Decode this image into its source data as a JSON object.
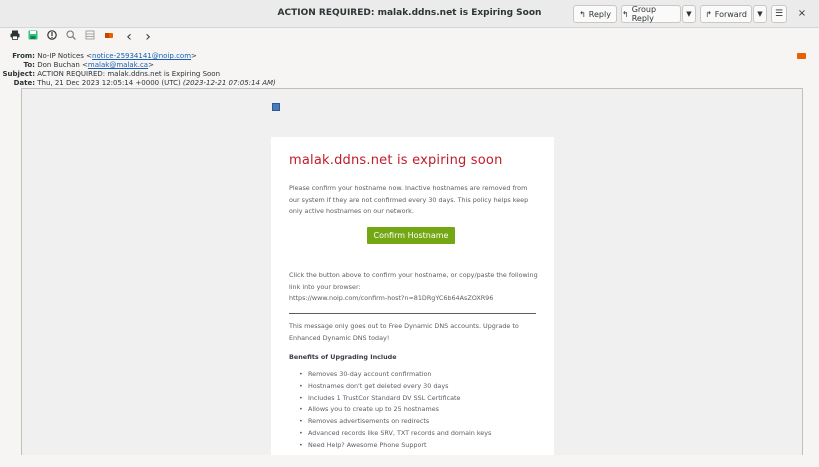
{
  "window": {
    "title": "ACTION REQUIRED: malak.ddns.net is Expiring Soon",
    "reply_label": "Reply",
    "group_reply_label": "Group Reply",
    "forward_label": "Forward",
    "close_glyph": "×",
    "dropdown_glyph": "▼",
    "menu_glyph": "☰"
  },
  "toolbar": {
    "icons": [
      "print-icon",
      "save-icon",
      "info-icon",
      "zoom-icon",
      "grid-icon",
      "flag-icon",
      "back-icon",
      "forward-icon"
    ],
    "back_glyph": "‹",
    "forward_glyph": "›"
  },
  "headers": {
    "from_label": "From:",
    "from_name": "No-IP Notices <",
    "from_email": "notice-25934141@noip.com",
    "from_close": ">",
    "to_label": "To:",
    "to_name": "Don Buchan <",
    "to_email": "malak@malak.ca",
    "to_close": ">",
    "subject_label": "Subject:",
    "subject": "ACTION REQUIRED: malak.ddns.net is Expiring Soon",
    "date_label": "Date:",
    "date": "Thu, 21 Dec 2023 12:05:14 +0000 (UTC) ",
    "date_local": "(2023-12-21 07:05:14 AM)"
  },
  "email": {
    "heading": "malak.ddns.net is expiring soon",
    "intro": "Please confirm your hostname now. Inactive hostnames are removed from our system if they are not confirmed every 30 days. This policy helps keep only active hostnames on our network.",
    "button_label": "Confirm Hostname",
    "link_text": "Click the button above to confirm your hostname, or copy/paste the following link into your browser:",
    "link_url": "https://www.noip.com/confirm-host?n=81DRgYC6b64AsZOXR96",
    "notice": "This message only goes out to Free Dynamic DNS accounts. Upgrade to Enhanced Dynamic DNS today!",
    "benefits_heading": "Benefits of Upgrading Include",
    "benefits": [
      "Removes 30-day account confirmation",
      "Hostnames don't get deleted every 30 days",
      "Includes 1 TrustCor Standard DV SSL Certificate",
      "Allows you to create up to 25 hostnames",
      "Removes advertisements on redirects",
      "Advanced records like SRV, TXT records and domain keys",
      "Need Help? Awesome Phone Support"
    ]
  },
  "colors": {
    "heading_red": "#c01c28",
    "button_green": "#73a814",
    "link_blue": "#1a5fb4"
  }
}
